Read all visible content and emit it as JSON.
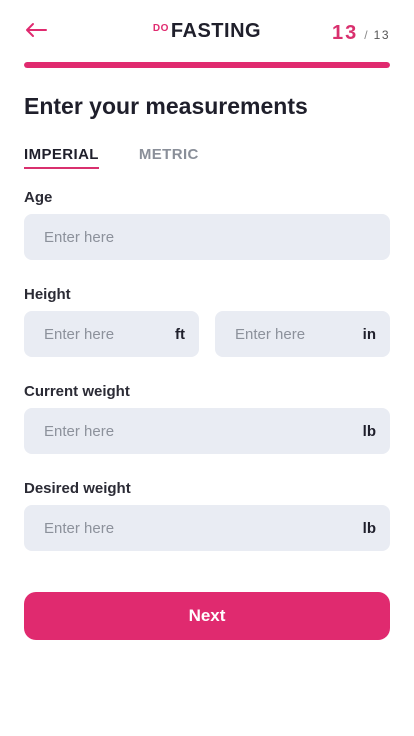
{
  "header": {
    "logo_prefix": "DO",
    "logo_main": "FASTING",
    "step_current": "13",
    "step_separator": "/",
    "step_total": "13",
    "back_icon": "arrow-left-icon",
    "accent_color": "#e02a6f"
  },
  "progress": {
    "fraction": 1.0
  },
  "title": "Enter your measurements",
  "tabs": [
    {
      "label": "IMPERIAL",
      "active": true
    },
    {
      "label": "METRIC",
      "active": false
    }
  ],
  "fields": {
    "age": {
      "label": "Age",
      "placeholder": "Enter here",
      "value": ""
    },
    "height": {
      "label": "Height",
      "feet": {
        "placeholder": "Enter here",
        "unit": "ft",
        "value": ""
      },
      "inches": {
        "placeholder": "Enter here",
        "unit": "in",
        "value": ""
      }
    },
    "current_weight": {
      "label": "Current weight",
      "placeholder": "Enter here",
      "unit": "lb",
      "value": ""
    },
    "desired_weight": {
      "label": "Desired weight",
      "placeholder": "Enter here",
      "unit": "lb",
      "value": ""
    }
  },
  "next_label": "Next"
}
